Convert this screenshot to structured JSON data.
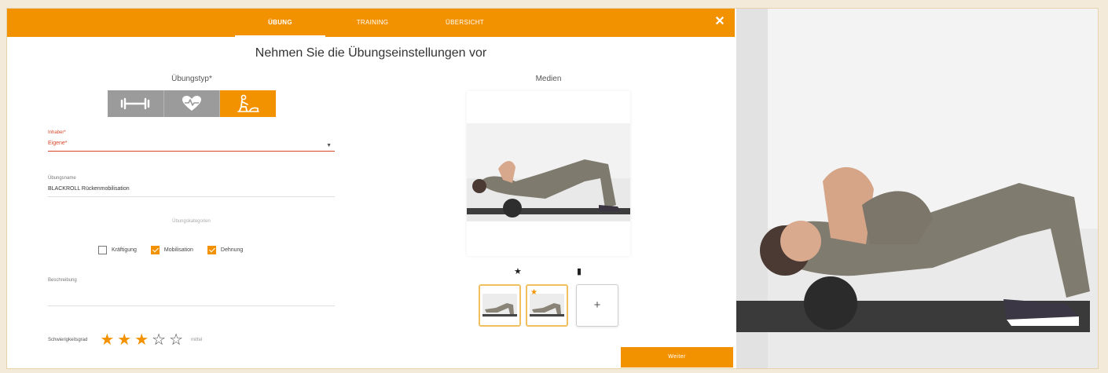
{
  "tabs": [
    {
      "label": "Übung",
      "active": true
    },
    {
      "label": "Training",
      "active": false
    },
    {
      "label": "Übersicht",
      "active": false
    }
  ],
  "close_icon": "close-icon",
  "title": "Nehmen Sie die Übungseinstellungen vor",
  "exercise_type": {
    "label": "Übungstyp*",
    "options": [
      {
        "icon": "dumbbell-icon",
        "active": false
      },
      {
        "icon": "heart-rate-icon",
        "active": false
      },
      {
        "icon": "stretching-icon",
        "active": true
      }
    ]
  },
  "owner_field": {
    "label": "Inhaber*",
    "value": "Eigene*",
    "error": true
  },
  "name_field": {
    "label": "Übungsname",
    "value": "BLACKROLL Rückenmobilisation"
  },
  "categories": {
    "label": "Übungskategorien",
    "items": [
      {
        "label": "Kräftigung",
        "checked": false
      },
      {
        "label": "Mobilisation",
        "checked": true
      },
      {
        "label": "Dehnung",
        "checked": true
      }
    ]
  },
  "description_field": {
    "label": "Beschreibung",
    "value": ""
  },
  "difficulty": {
    "label": "Schwierigkeitsgrad",
    "rating": 3,
    "max": 5,
    "text": "mittel"
  },
  "media": {
    "label": "Medien",
    "favorite_icon": "star-icon",
    "delete_icon": "trash-icon",
    "add_label": "+"
  },
  "next_button": "Weiter",
  "colors": {
    "accent": "#f39200",
    "error": "#d9472b"
  }
}
